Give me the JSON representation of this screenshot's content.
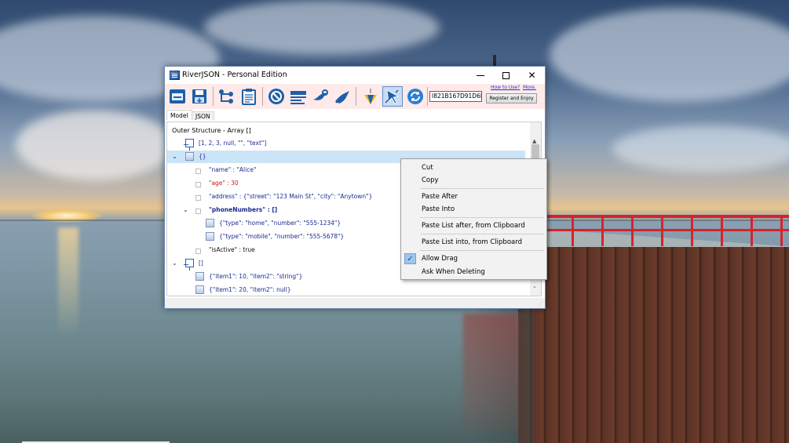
{
  "window": {
    "title": "RiverJSON - Personal Edition",
    "close_glyph": "✕"
  },
  "toolbar": {
    "license_code": "I821B167D91D6D23",
    "how_to_use_link": "How to Use?",
    "more_link": "More.",
    "register_label": "Register and Enjoy",
    "icons": [
      "open-icon",
      "save-icon",
      "tree-icon",
      "clipboard-icon",
      "no-link-icon",
      "form-icon",
      "wrench-icon",
      "pen-icon",
      "pick-icon",
      "drag-icon",
      "refresh-icon"
    ],
    "active_icon": "drag-icon"
  },
  "tabs": [
    {
      "label": "Model",
      "selected": true
    },
    {
      "label": "JSON",
      "selected": false
    }
  ],
  "tree": {
    "header": "Outer Structure - Array []",
    "rows": [
      {
        "expander": "",
        "icon": "array",
        "text": "[1, 2, 3, null, \"\", \"text\"]",
        "color": "blue",
        "selected": false
      },
      {
        "expander": "⌄",
        "icon": "doc",
        "text": "{}",
        "color": "blue",
        "selected": true
      },
      {
        "expander": "",
        "icon": "leaf",
        "text": "\"name\" : \"Alice\"",
        "color": "blue",
        "selected": false
      },
      {
        "expander": "",
        "icon": "leaf",
        "text": "\"age\" : 30",
        "color": "red",
        "selected": false
      },
      {
        "expander": "",
        "icon": "leaf",
        "text": "\"address\" : {\"street\": \"123 Main St\", \"city\": \"Anytown\"}",
        "color": "blue",
        "selected": false
      },
      {
        "expander": "⌄",
        "icon": "leaf",
        "text": "\"phoneNumbers\" : []",
        "color": "bold",
        "selected": false
      },
      {
        "expander": "",
        "icon": "doc",
        "text": "{\"type\": \"home\", \"number\": \"555-1234\"}",
        "color": "blue",
        "selected": false
      },
      {
        "expander": "",
        "icon": "doc",
        "text": "{\"type\": \"mobile\", \"number\": \"555-5678\"}",
        "color": "blue",
        "selected": false
      },
      {
        "expander": "",
        "icon": "leaf",
        "text": "\"isActive\" : true",
        "color": "black",
        "selected": false
      },
      {
        "expander": "⌄",
        "icon": "array",
        "text": "[]",
        "color": "blue",
        "selected": false
      },
      {
        "expander": "",
        "icon": "doc",
        "text": "{\"item1\": 10, \"item2\": \"string\"}",
        "color": "blue",
        "selected": false
      },
      {
        "expander": "",
        "icon": "doc",
        "text": "{\"item1\": 20, \"item2\": null}",
        "color": "blue",
        "selected": false
      }
    ]
  },
  "scroll": {
    "up": "▲",
    "down": "⌄"
  },
  "context_menu": {
    "items": [
      {
        "label": "Cut",
        "checked": false
      },
      {
        "label": "Copy",
        "checked": false
      },
      {
        "label": "Paste After",
        "checked": false
      },
      {
        "label": "Paste Into",
        "checked": false
      },
      {
        "label": "Paste List after, from Clipboard",
        "checked": false
      },
      {
        "label": "Paste List into, from Clipboard",
        "checked": false
      },
      {
        "label": "Allow Drag",
        "checked": true
      },
      {
        "label": "Ask When Deleting",
        "checked": false
      }
    ],
    "check_glyph": "✓"
  }
}
